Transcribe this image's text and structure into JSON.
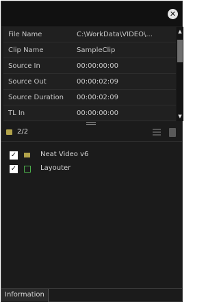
{
  "window": {
    "close_glyph": "✕"
  },
  "properties": {
    "rows": [
      {
        "name": "File Name",
        "value": "C:\\WorkData\\VIDEO\\..."
      },
      {
        "name": "Clip Name",
        "value": "SampleClip"
      },
      {
        "name": "Source In",
        "value": "00:00:00:00"
      },
      {
        "name": "Source Out",
        "value": "00:00:02:09"
      },
      {
        "name": "Source Duration",
        "value": "00:00:02:09"
      },
      {
        "name": "TL In",
        "value": "00:00:00:00"
      }
    ],
    "scroll_up_glyph": "▲",
    "scroll_down_glyph": "▼"
  },
  "effects": {
    "count_label": "2/2",
    "icons": {
      "toolbar": "film-icon",
      "list": "list-icon",
      "delete": "trash-icon"
    },
    "items": [
      {
        "label": "Neat Video v6",
        "checked": true,
        "icon": "film-icon",
        "check_glyph": "✓"
      },
      {
        "label": "Layouter",
        "checked": true,
        "icon": "layouter-icon",
        "check_glyph": "✓"
      }
    ]
  },
  "tabs": {
    "information": "Information"
  },
  "colors": {
    "background": "#1b1b1b",
    "accent_film": "#b2a34a",
    "accent_layouter": "#4cb04c"
  }
}
